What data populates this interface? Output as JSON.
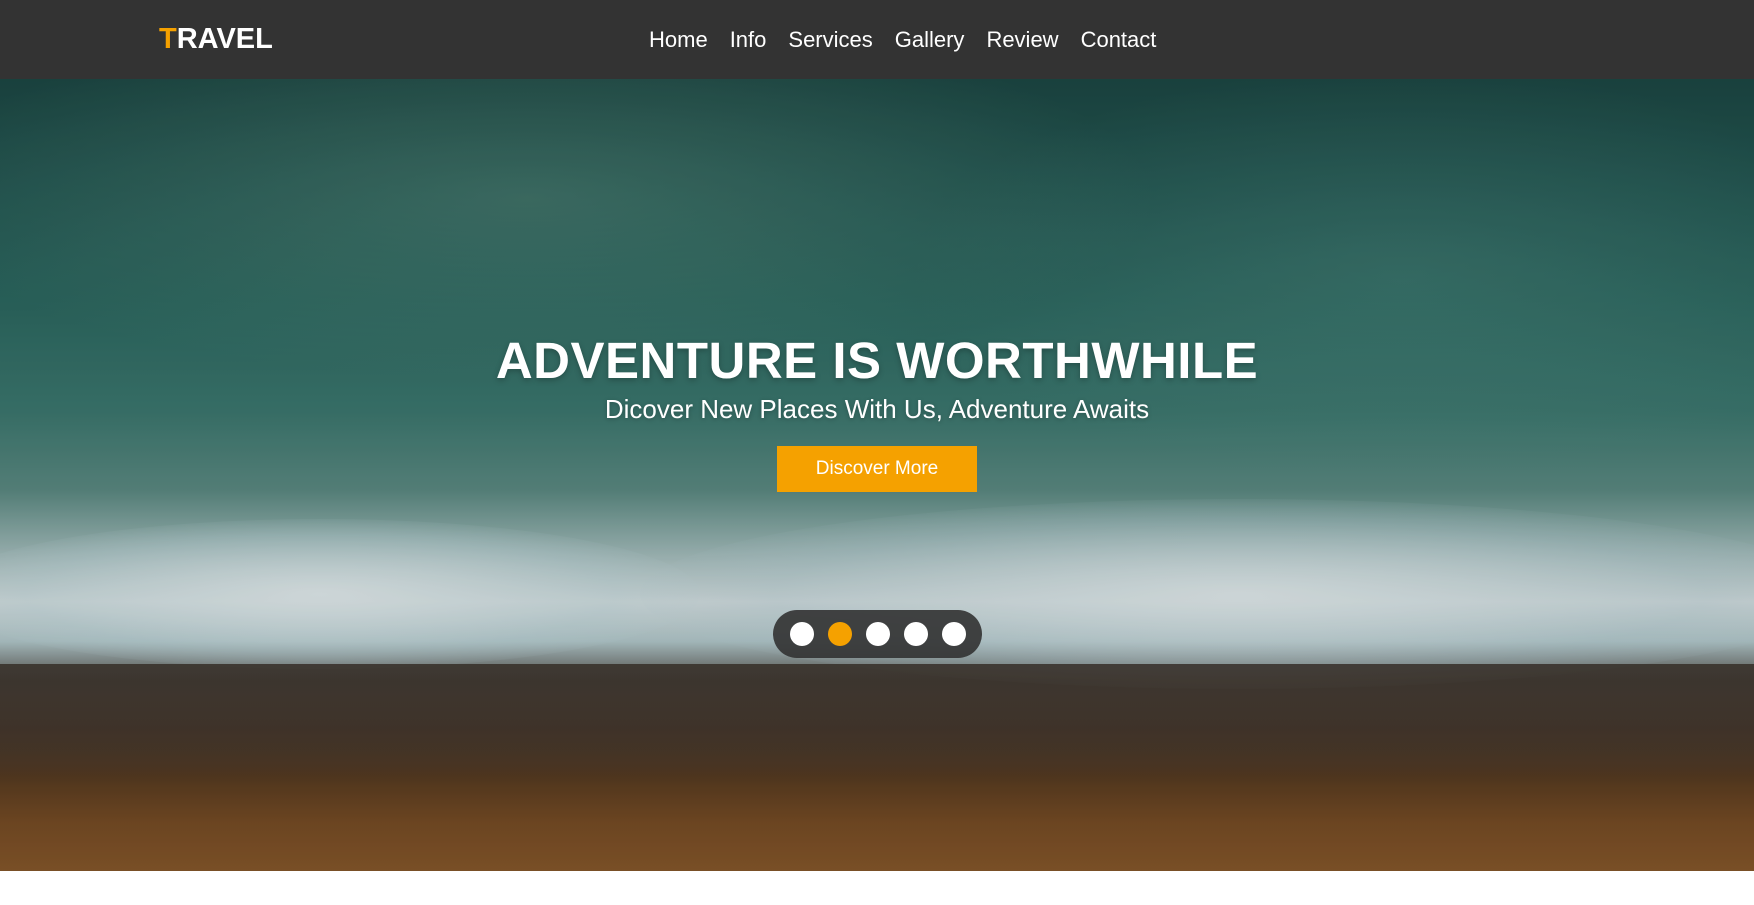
{
  "header": {
    "logo_first_letter": "T",
    "logo_rest": "RAVEL",
    "nav": [
      {
        "label": "Home"
      },
      {
        "label": "Info"
      },
      {
        "label": "Services"
      },
      {
        "label": "Gallery"
      },
      {
        "label": "Review"
      },
      {
        "label": "Contact"
      }
    ]
  },
  "hero": {
    "title": "ADVENTURE IS WORTHWHILE",
    "subtitle": "Dicover New Places With Us, Adventure Awaits",
    "cta_label": "Discover More",
    "background_image": "aerial-ocean-waves-beach",
    "slider": {
      "total": 5,
      "active_index": 1
    }
  },
  "colors": {
    "navbar_bg": "#333333",
    "accent": "#f5a100",
    "text": "#ffffff",
    "slider_bg": "#323232"
  }
}
